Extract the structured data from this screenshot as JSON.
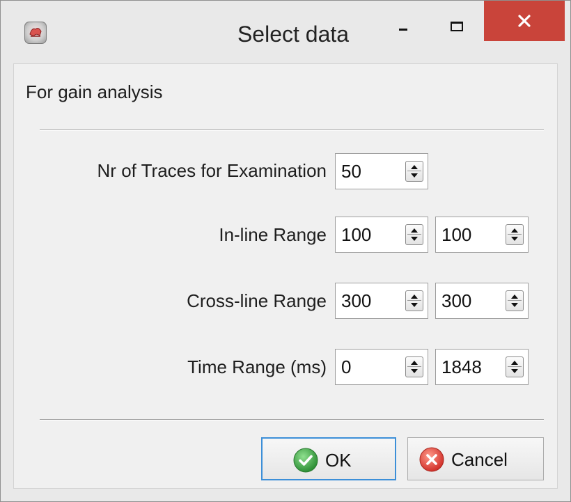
{
  "window": {
    "title": "Select data"
  },
  "heading": "For gain analysis",
  "fields": {
    "traces": {
      "label": "Nr of Traces for Examination",
      "value": "50"
    },
    "inline": {
      "label": "In-line Range",
      "from": "100",
      "to": "100"
    },
    "crossline": {
      "label": "Cross-line Range",
      "from": "300",
      "to": "300"
    },
    "time": {
      "label": "Time Range (ms)",
      "from": "0",
      "to": "1848"
    }
  },
  "buttons": {
    "ok": "OK",
    "cancel": "Cancel"
  },
  "icons": {
    "app": "app-logo-icon",
    "minimize": "minimize-icon",
    "maximize": "maximize-icon",
    "close": "close-icon",
    "ok": "check-circle-icon",
    "cancel": "x-circle-icon"
  },
  "colors": {
    "close_button": "#c9443a",
    "ok_focus_border": "#3c8fd8",
    "ok_icon": "#3aa83f",
    "cancel_icon": "#e0443a"
  }
}
